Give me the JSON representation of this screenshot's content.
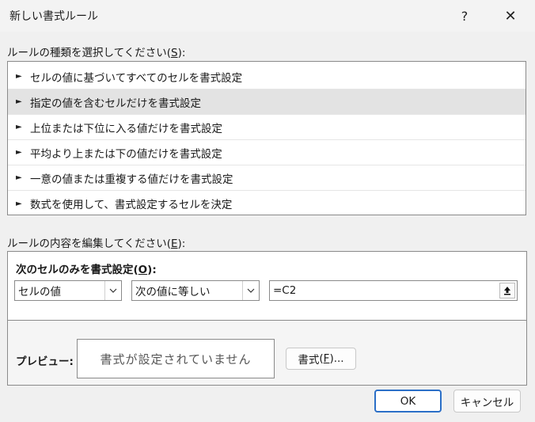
{
  "window": {
    "title": "新しい書式ルール",
    "help_label": "?",
    "close_label": "✕"
  },
  "rule_type": {
    "label": "ルールの種類を選択してください",
    "mnemonic": "S",
    "items": [
      {
        "label": "セルの値に基づいてすべてのセルを書式設定",
        "selected": false
      },
      {
        "label": "指定の値を含むセルだけを書式設定",
        "selected": true
      },
      {
        "label": "上位または下位に入る値だけを書式設定",
        "selected": false
      },
      {
        "label": "平均より上または下の値だけを書式設定",
        "selected": false
      },
      {
        "label": "一意の値または重複する値だけを書式設定",
        "selected": false
      },
      {
        "label": "数式を使用して、書式設定するセルを決定",
        "selected": false
      }
    ]
  },
  "rule_edit": {
    "label": "ルールの内容を編集してください",
    "mnemonic": "E",
    "subheading": "次のセルのみを書式設定",
    "subheading_mnemonic": "O",
    "condition_type": "セルの値",
    "operator": "次の値に等しい",
    "value": "=C2",
    "preview_label": "プレビュー:",
    "preview_text": "書式が設定されていません",
    "format_button": "書式",
    "format_mnemonic": "F",
    "format_ellipsis": "..."
  },
  "buttons": {
    "ok": "OK",
    "cancel": "キャンセル"
  }
}
